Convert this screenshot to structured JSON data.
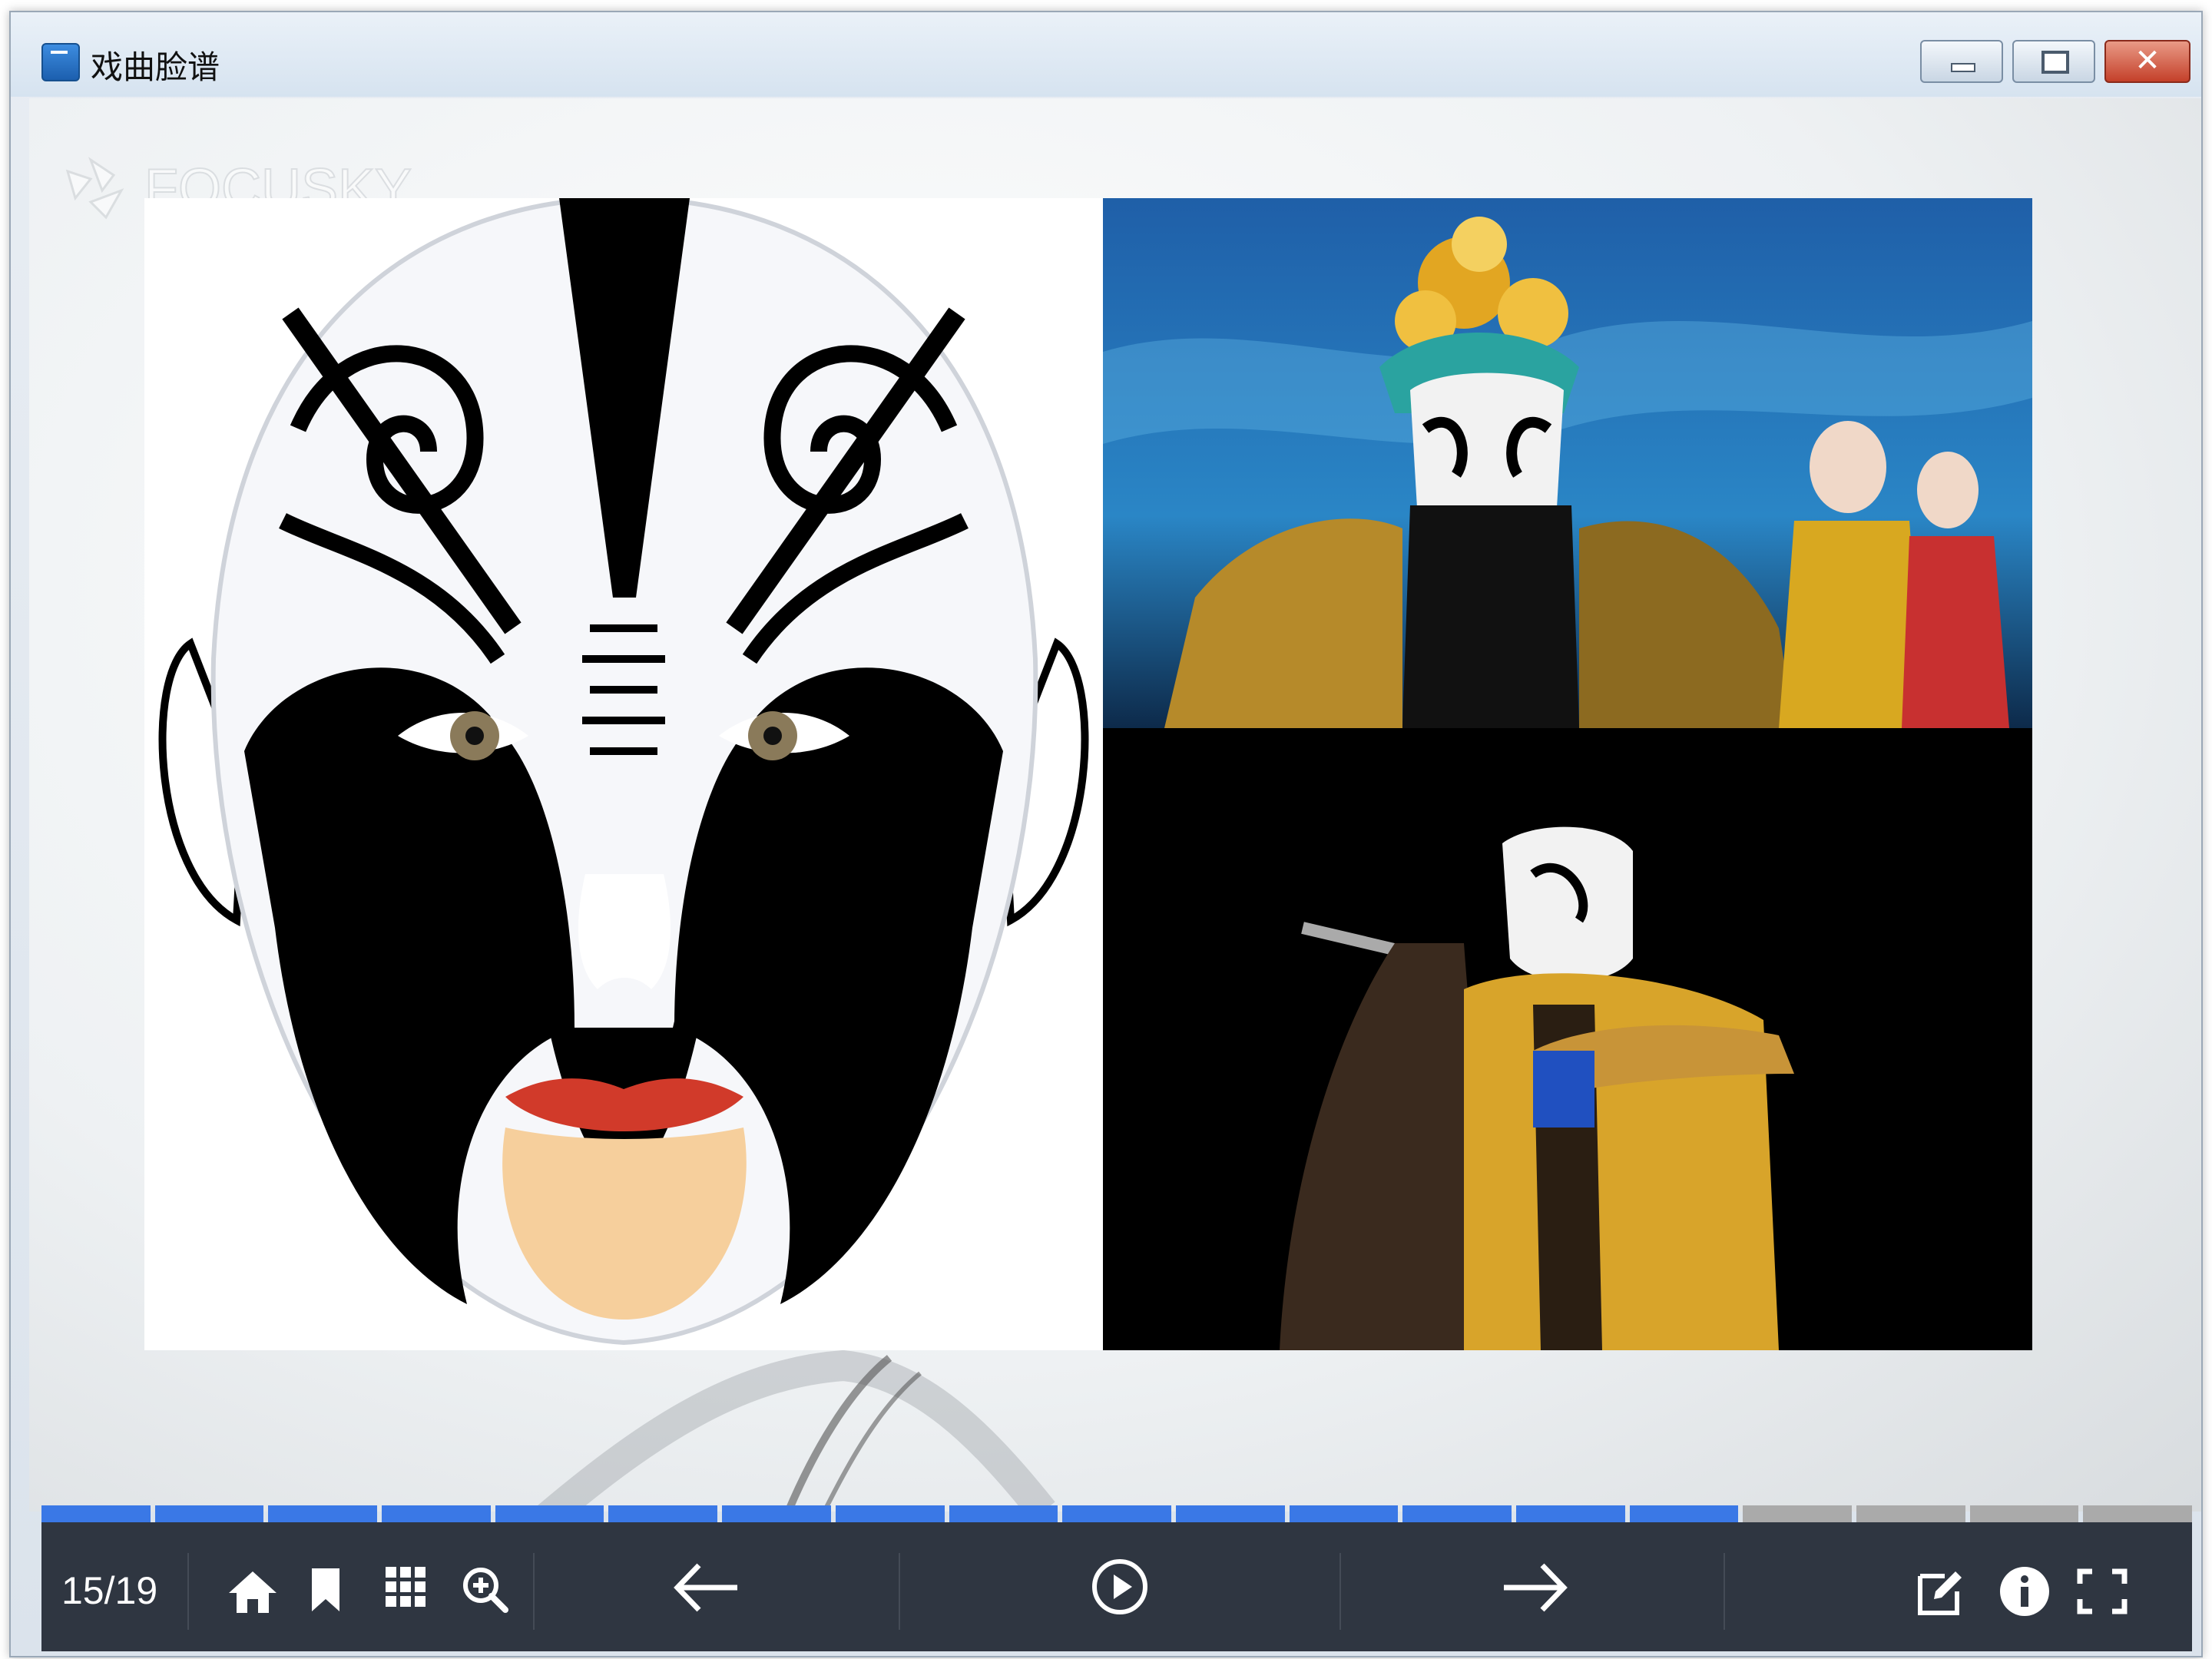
{
  "window": {
    "title": "戏曲脸谱",
    "controls": {
      "minimize": "minimize",
      "maximize": "maximize",
      "close": "✕"
    }
  },
  "watermark": {
    "text": "FOCUSKY"
  },
  "slide": {
    "images": [
      {
        "name": "opera-mask-illustration",
        "description_color": "#000000"
      },
      {
        "name": "opera-performer-stage-photo"
      },
      {
        "name": "opera-performer-bearded-photo"
      }
    ]
  },
  "progress": {
    "current": 15,
    "total": 19
  },
  "toolbar": {
    "page_counter": "15/19",
    "icons": [
      "home-icon",
      "bookmark-icon",
      "grid-icon",
      "zoom-in-icon",
      "arrow-left-icon",
      "play-icon",
      "arrow-right-icon",
      "edit-icon",
      "info-icon",
      "fullscreen-icon"
    ]
  },
  "colors": {
    "toolbar_bg": "#2f3641",
    "progress_active": "#3a78e6",
    "progress_inactive": "#aaaaaa"
  }
}
